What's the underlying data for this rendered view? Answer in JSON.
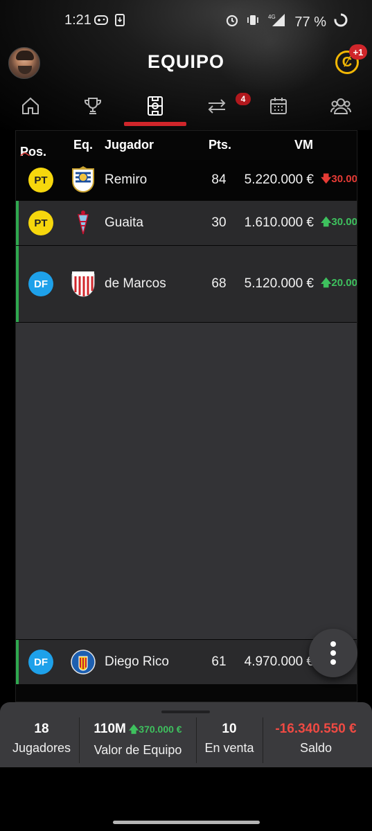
{
  "status_bar": {
    "time": "1:21",
    "network_label": "4G",
    "battery": "77 %"
  },
  "header": {
    "title": "EQUIPO",
    "coin_symbol": "Ȼ",
    "coin_badge": "+1"
  },
  "tabs": {
    "items": [
      {
        "name": "home",
        "icon": "home-icon"
      },
      {
        "name": "trophy",
        "icon": "trophy-icon"
      },
      {
        "name": "team",
        "icon": "lineup-icon",
        "active": true
      },
      {
        "name": "transfers",
        "icon": "transfer-icon",
        "badge": "4"
      },
      {
        "name": "calendar",
        "icon": "calendar-icon"
      },
      {
        "name": "community",
        "icon": "users-icon"
      }
    ],
    "transfers_badge": "4"
  },
  "table": {
    "headers": {
      "pos": "Pos.",
      "team": "Eq.",
      "player": "Jugador",
      "points": "Pts.",
      "value": "VM"
    },
    "rows": [
      {
        "pos": "PT",
        "crest": "real-sociedad-crest",
        "name": "Remiro",
        "points": "84",
        "value": "5.220.000 €",
        "change": "30.00",
        "direction": "down"
      },
      {
        "pos": "PT",
        "crest": "celta-crest",
        "name": "Guaita",
        "points": "30",
        "value": "1.610.000 €",
        "change": "30.00",
        "direction": "up"
      },
      {
        "pos": "DF",
        "crest": "athletic-club-crest",
        "name": "de Marcos",
        "points": "68",
        "value": "5.120.000 €",
        "change": "20.00",
        "direction": "up"
      },
      {
        "pos": "DF",
        "crest": "getafe-crest",
        "name": "Diego Rico",
        "points": "61",
        "value": "4.970.000 €",
        "change": "",
        "direction": "up"
      }
    ]
  },
  "summary": {
    "players_value": "18",
    "players_label": "Jugadores",
    "team_value": "110M",
    "team_change": "370.000 €",
    "team_label": "Valor de Equipo",
    "on_sale_value": "10",
    "on_sale_label": "En venta",
    "balance_value": "-16.340.550 €",
    "balance_label": "Saldo"
  },
  "colors": {
    "accent_red": "#d0262b",
    "up_green": "#3ec15e",
    "down_red": "#e63b35",
    "gk_yellow": "#f6d70d",
    "df_blue": "#1ea1ea"
  }
}
